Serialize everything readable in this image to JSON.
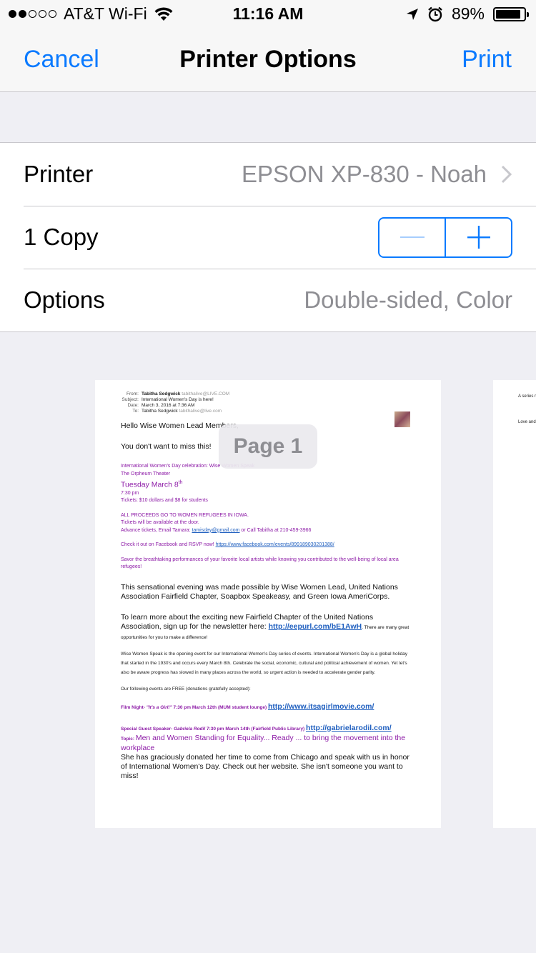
{
  "status_bar": {
    "carrier": "AT&T Wi-Fi",
    "time": "11:16 AM",
    "battery": "89%",
    "battery_level": 0.89,
    "signal_bars": 2
  },
  "nav": {
    "cancel": "Cancel",
    "title": "Printer Options",
    "print": "Print"
  },
  "rows": {
    "printer_label": "Printer",
    "printer_value": "EPSON XP-830 - Noah",
    "copies_label": "1 Copy",
    "options_label": "Options",
    "options_value": "Double-sided, Color"
  },
  "colors": {
    "accent": "#0a7aff",
    "secondary_text": "#8e8e93",
    "email_purple": "#8c1aa6"
  },
  "page_badge": "Page 1",
  "email": {
    "from_key": "From:",
    "from_name": "Tabitha Sedgwick",
    "from_email": "tabithalive@LIVE.COM",
    "subject_key": "Subject:",
    "subject": "International Women's Day is here!",
    "date_key": "Date:",
    "date": "March 3, 2016 at 7:36 AM",
    "to_key": "To:",
    "to_name": "Tabitha Sedgwick",
    "to_email": "tabithalive@live.com",
    "greeting": "Hello Wise Women Lead Members,",
    "intro": "You don't want to miss this!",
    "event_line": "International Women's Day celebration: Wise Women Speak",
    "venue": "The Orpheum Theater",
    "event_date": "Tuesday March 8",
    "event_date_sup": "th",
    "event_time": "7:30 pm",
    "tickets": "Tickets: $10 dollars and $8 for students",
    "proceeds": "ALL PROCEEDS GO TO WOMEN REFUGEES IN IOWA.",
    "door": "Tickets will be available at the door.",
    "advance_prefix": "Advance tickets, Email Tamara: ",
    "advance_email": "tamisday@gmail.com",
    "advance_suffix": " or Call Tabitha at 210-459-3966",
    "facebook_prefix": "Check it out on Facebook and RSVP now! ",
    "facebook_link": "https://www.facebook.com/events/899189030201388/",
    "savor": "Savor the breathtaking performances of your favorite local artists while knowing you contributed to the well-being of local area refugees!",
    "sensational": "This sensational evening was made possible by Wise Women Lead, United Nations Association Fairfield Chapter, Soapbox Speakeasy, and Green Iowa AmeriCorps.",
    "learn_prefix": "To learn more about the exciting new Fairfield Chapter of the United Nations Association, sign up for the newsletter here: ",
    "learn_link": "http://eepurl.com/bE1AwH",
    "learn_suffix": ". There are many great opportunities for you to make a difference!",
    "wws_para": "Wise Women Speak is the opening event for our International Women's Day series of events. International Women's Day is a global holiday that started in the 1930's and occurs every March 8th. Celebrate the social, economic, cultural and political achievement of women. Yet let's also be aware progress has slowed in many places across the world, so urgent action is needed to accelerate gender parity.",
    "free_events": "Our following events are FREE (donations gratefully accepted):",
    "film_label": "Film Night-",
    "film_title": "\"It's a Girl!\"",
    "film_details": " 7:30 pm March 12th (MUM student lounge) ",
    "film_link": "http://www.itsagirlmovie.com/",
    "guest_label": "Special Guest Speaker-",
    "guest_name": "Gabriela Rodil",
    "guest_details": " 7:30 pm March 14th (Fairfield Public Library) ",
    "guest_link": "http://gabrielarodil.com/",
    "topic_label": "Topic: ",
    "topic_text": "Men and Women Standing for Equality... Ready ... to bring the movement into the workplace",
    "donated": "She has graciously donated her time to come from Chicago and speak with us in honor of International Women's Day. Check out her website. She isn't someone you want to miss!"
  },
  "page2": {
    "line1": "A series refugee",
    "line2": "Love and Wise W"
  }
}
